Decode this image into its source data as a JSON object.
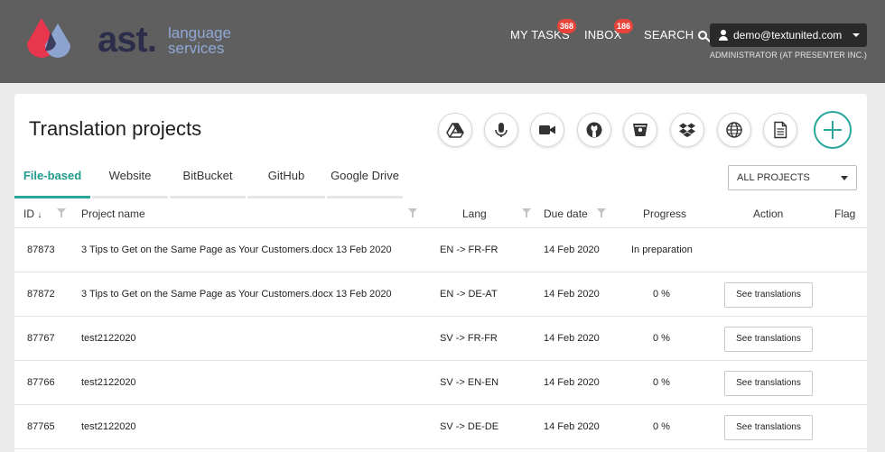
{
  "header": {
    "logo": {
      "main": "ast.",
      "sub_line1": "language",
      "sub_line2": "services"
    },
    "nav": {
      "tasks_label": "MY TASKS",
      "tasks_badge": "368",
      "inbox_label": "INBOX",
      "inbox_badge": "186",
      "search_label": "SEARCH"
    },
    "user": {
      "email": "demo@textunited.com",
      "role": "ADMINISTRATOR (AT PRESENTER INC.)"
    }
  },
  "page": {
    "title": "Translation projects",
    "integrations": [
      "google-drive-icon",
      "microphone-icon",
      "video-camera-icon",
      "github-icon",
      "bitbucket-icon",
      "dropbox-icon",
      "globe-icon",
      "document-icon"
    ],
    "tabs": [
      {
        "label": "File-based",
        "active": true
      },
      {
        "label": "Website"
      },
      {
        "label": "BitBucket"
      },
      {
        "label": "GitHub"
      },
      {
        "label": "Google Drive"
      }
    ],
    "filter": {
      "selected": "ALL PROJECTS"
    }
  },
  "table": {
    "columns": {
      "id": "ID",
      "sort_indicator": "↓",
      "name": "Project name",
      "lang": "Lang",
      "due": "Due date",
      "progress": "Progress",
      "action": "Action",
      "flag": "Flag"
    },
    "action_label": "See translations",
    "rows": [
      {
        "id": "87873",
        "name": "3 Tips to Get on the Same Page as Your Customers.docx 13 Feb 2020",
        "lang": "EN -> FR-FR",
        "due": "14 Feb 2020",
        "progress": "In preparation",
        "has_action": false
      },
      {
        "id": "87872",
        "name": "3 Tips to Get on the Same Page as Your Customers.docx 13 Feb 2020",
        "lang": "EN -> DE-AT",
        "due": "14 Feb 2020",
        "progress": "0 %",
        "has_action": true
      },
      {
        "id": "87767",
        "name": "test2122020",
        "lang": "SV -> FR-FR",
        "due": "14 Feb 2020",
        "progress": "0 %",
        "has_action": true
      },
      {
        "id": "87766",
        "name": "test2122020",
        "lang": "SV -> EN-EN",
        "due": "14 Feb 2020",
        "progress": "0 %",
        "has_action": true
      },
      {
        "id": "87765",
        "name": "test2122020",
        "lang": "SV -> DE-DE",
        "due": "14 Feb 2020",
        "progress": "0 %",
        "has_action": true
      }
    ]
  },
  "colors": {
    "accent": "#2aa69a",
    "header_bg": "#5f5f5f",
    "badge": "#e8443a",
    "logo_dark": "#2b2d4a",
    "logo_light": "#8fa8d6",
    "logo_red": "#e8364f"
  }
}
